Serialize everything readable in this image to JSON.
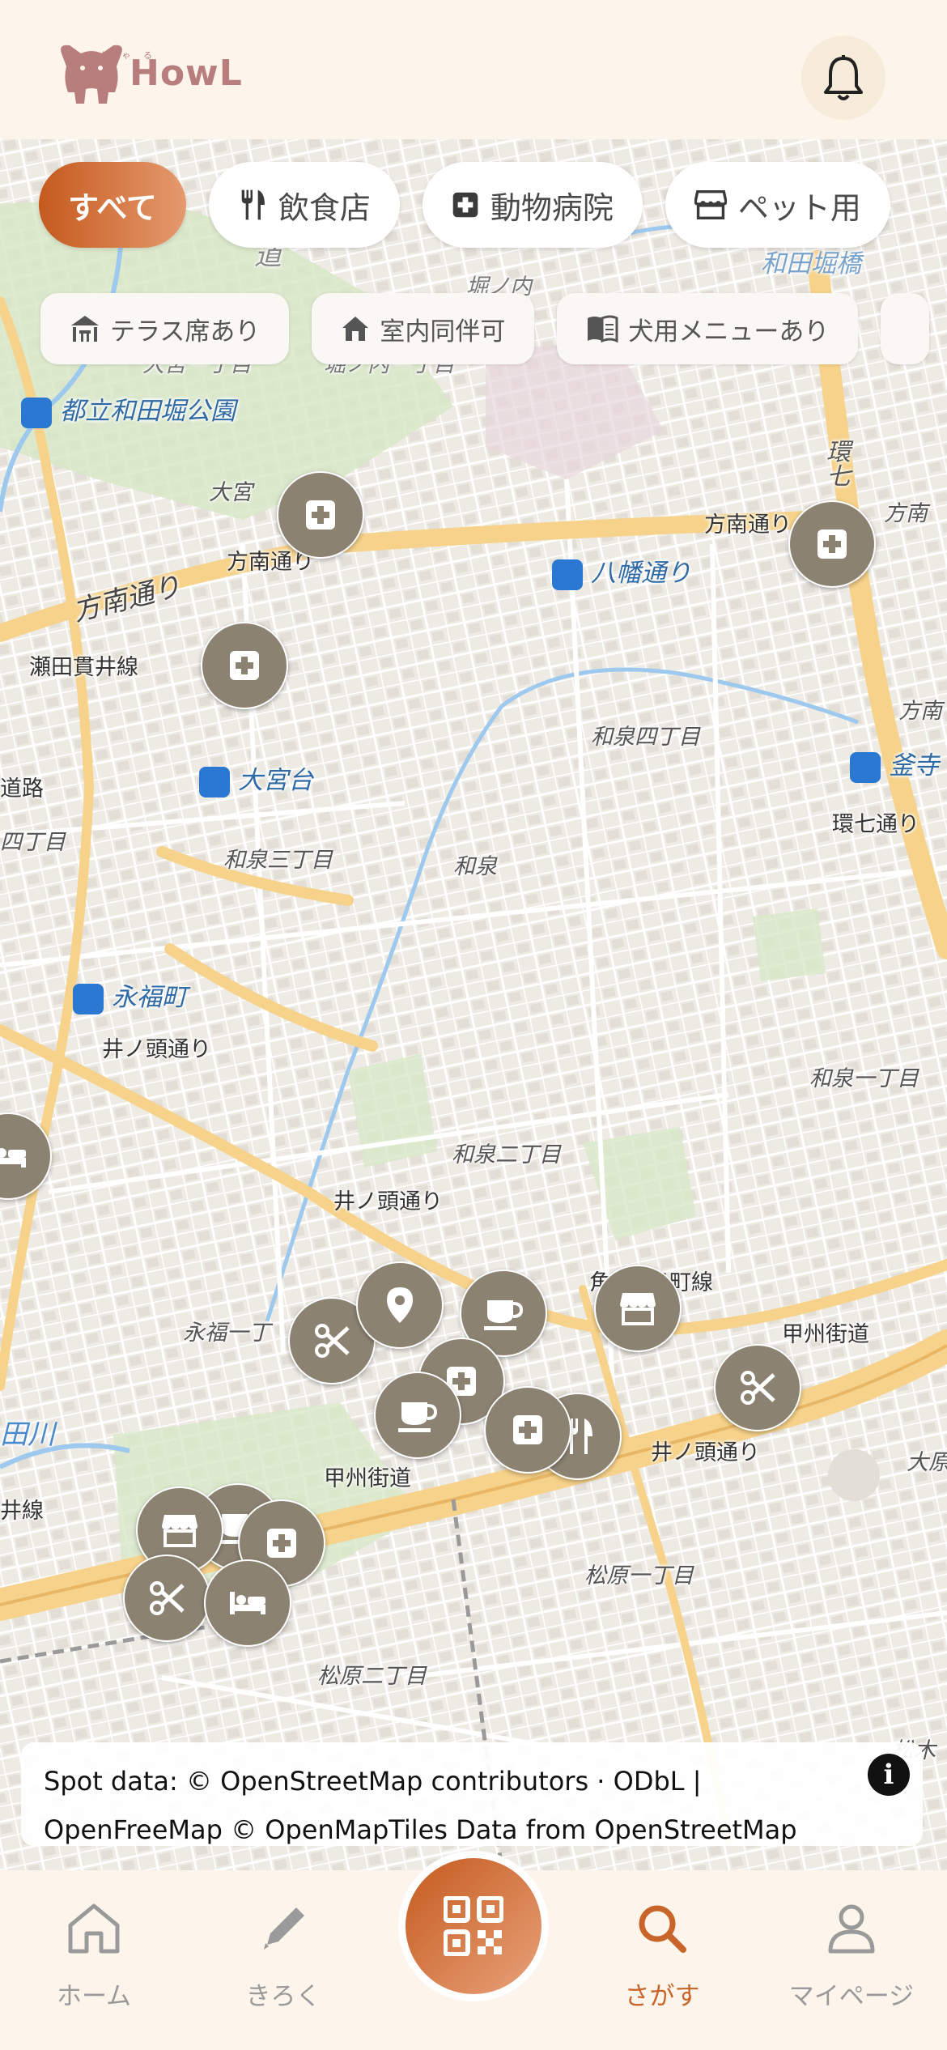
{
  "app": {
    "name": "HowL",
    "logo_sub": "れ ゃ る"
  },
  "header": {
    "bell_icon": "bell-icon"
  },
  "category_chips": [
    {
      "label": "すべて",
      "icon": "",
      "active": true
    },
    {
      "label": "飲食店",
      "icon": "fork-knife-icon",
      "active": false
    },
    {
      "label": "動物病院",
      "icon": "medical-cross-icon",
      "active": false
    },
    {
      "label": "ペット用",
      "icon": "store-icon",
      "active": false
    }
  ],
  "filter_chips": [
    {
      "label": "テラス席あり",
      "icon": "terrace-icon"
    },
    {
      "label": "室内同伴可",
      "icon": "house-icon"
    },
    {
      "label": "犬用メニューあり",
      "icon": "menu-book-icon"
    }
  ],
  "map_labels": {
    "l1": "都立和田堀公園",
    "l2": "大宮",
    "l3": "方南通り",
    "l4": "方南通り",
    "l5": "瀬田貫井線",
    "l6": "大宮台",
    "l7": "和泉三丁目",
    "l8": "和泉",
    "l9": "和泉四丁目",
    "l10": "八幡通り",
    "l11": "方南通り",
    "l12": "環七",
    "l13": "方南",
    "l14": "方南",
    "l15": "釜寺",
    "l16": "環七通り",
    "l17": "永福町",
    "l18": "井ノ頭通り",
    "l19": "和泉二丁目",
    "l20": "井ノ頭通り",
    "l21": "和泉一丁目",
    "l22": "永福一丁",
    "l23": "角",
    "l24": "泉町線",
    "l25": "甲州街道",
    "l26": "甲州街道",
    "l27": "井ノ頭通り",
    "l28": "松原一丁目",
    "l29": "松原二丁目",
    "l30": "大原",
    "l31": "田川",
    "l32": "井線",
    "l33": "道路",
    "l34": "四丁目",
    "l35": "大宮一丁目",
    "l36": "堀ノ内一丁目",
    "l37": "堀ノ内",
    "l38": "和田堀橋",
    "l39": "道",
    "l40": "松木"
  },
  "markers": [
    {
      "type": "vet",
      "icon": "medical-cross-icon"
    },
    {
      "type": "vet",
      "icon": "medical-cross-icon"
    },
    {
      "type": "vet",
      "icon": "medical-cross-icon"
    },
    {
      "type": "hotel",
      "icon": "bed-icon"
    },
    {
      "type": "grooming",
      "icon": "scissors-icon"
    },
    {
      "type": "spot",
      "icon": "location-pin-icon"
    },
    {
      "type": "cafe",
      "icon": "cup-icon"
    },
    {
      "type": "shop",
      "icon": "store-icon"
    },
    {
      "type": "grooming",
      "icon": "scissors-icon"
    },
    {
      "type": "vet",
      "icon": "medical-cross-icon"
    },
    {
      "type": "cafe",
      "icon": "cup-icon"
    },
    {
      "type": "restaurant",
      "icon": "fork-knife-icon"
    },
    {
      "type": "vet",
      "icon": "medical-cross-icon"
    },
    {
      "type": "shop",
      "icon": "store-icon"
    },
    {
      "type": "cafe",
      "icon": "cup-icon"
    },
    {
      "type": "vet",
      "icon": "medical-cross-icon"
    },
    {
      "type": "grooming",
      "icon": "scissors-icon"
    },
    {
      "type": "hotel",
      "icon": "bed-icon"
    }
  ],
  "attribution": {
    "line1": "Spot data: © OpenStreetMap contributors · ODbL |",
    "line2": "OpenFreeMap © OpenMapTiles Data from OpenStreetMap",
    "info": "i"
  },
  "bottom_nav": [
    {
      "label": "ホーム",
      "icon": "home-icon",
      "active": false
    },
    {
      "label": "きろく",
      "icon": "pencil-icon",
      "active": false
    },
    {
      "label": "",
      "icon": "qr-code-icon",
      "active": false
    },
    {
      "label": "さがす",
      "icon": "search-icon",
      "active": true
    },
    {
      "label": "マイページ",
      "icon": "user-icon",
      "active": false
    }
  ],
  "colors": {
    "accent": "#c8652a",
    "marker": "#8b8272",
    "background": "#fdf5ec",
    "road_major": "#f6d28a",
    "water": "#9ec9ee"
  }
}
